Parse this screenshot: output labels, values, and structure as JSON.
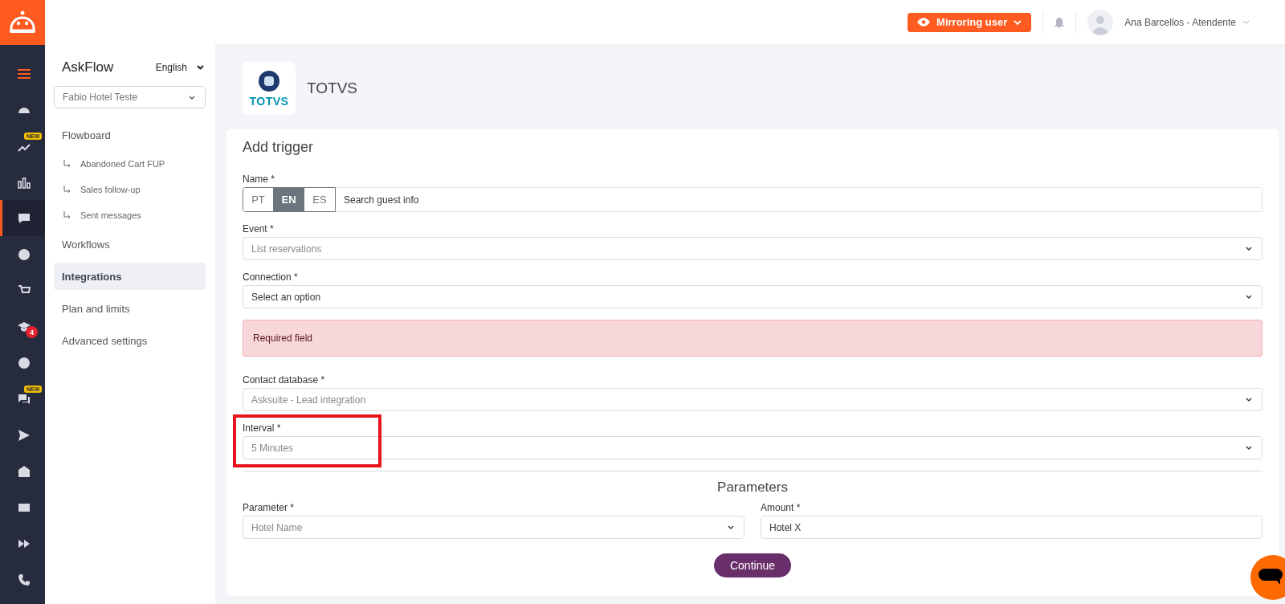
{
  "topbar": {
    "mirror_button": "Mirroring user",
    "user_name": "Ana Barcellos - Atendente"
  },
  "rail": [
    {
      "selected": false
    },
    {
      "selected": false
    },
    {
      "selected": false,
      "badge": {
        "kind": "new",
        "text": "NEW"
      }
    },
    {
      "selected": false
    },
    {
      "selected": true
    },
    {
      "selected": false
    },
    {
      "selected": false
    },
    {
      "selected": false,
      "badge": {
        "kind": "count",
        "text": "4"
      }
    },
    {
      "selected": false
    },
    {
      "selected": false,
      "badge": {
        "kind": "new",
        "text": "NEW"
      }
    },
    {
      "selected": false
    },
    {
      "selected": false
    },
    {
      "selected": false
    },
    {
      "selected": false
    },
    {
      "selected": false
    }
  ],
  "sidebar": {
    "title": "AskFlow",
    "language": "English",
    "account": "Fabio Hotel Teste",
    "items": [
      {
        "label": "Flowboard",
        "selected": false,
        "children": [
          {
            "label": "Abandoned Cart FUP"
          },
          {
            "label": "Sales follow-up"
          },
          {
            "label": "Sent messages"
          }
        ]
      },
      {
        "label": "Workflows",
        "selected": false
      },
      {
        "label": "Integrations",
        "selected": true
      },
      {
        "label": "Plan and limits",
        "selected": false
      },
      {
        "label": "Advanced settings",
        "selected": false
      }
    ]
  },
  "integration": {
    "logo_text": "TOTVS",
    "name": "TOTVS"
  },
  "form": {
    "title": "Add trigger",
    "fields": [
      {
        "kind": "translated",
        "label": "Name *",
        "languages": [
          {
            "label": "PT",
            "selected": false
          },
          {
            "label": "EN",
            "selected": true
          },
          {
            "label": "ES",
            "selected": false
          }
        ],
        "value": "Search guest info"
      },
      {
        "kind": "select",
        "label": "Event *",
        "value": "List reservations",
        "disabled": true
      },
      {
        "kind": "select",
        "label": "Connection *",
        "value": "Select an option",
        "disabled": false
      },
      {
        "kind": "alert",
        "text": "Required field"
      },
      {
        "kind": "select",
        "label": "Contact database *",
        "value": "Asksuite - Lead integration",
        "disabled": true
      },
      {
        "kind": "select",
        "label": "Interval *",
        "value": "5 Minutes",
        "disabled": true,
        "highlighted": true
      }
    ],
    "parameters": {
      "title": "Parameters",
      "fields": [
        {
          "kind": "select",
          "label": "Parameter *",
          "value": "Hotel Name",
          "disabled": true
        },
        {
          "kind": "input",
          "label": "Amount *",
          "value": "Hotel X",
          "disabled": false
        }
      ]
    },
    "submit": "Continue"
  }
}
